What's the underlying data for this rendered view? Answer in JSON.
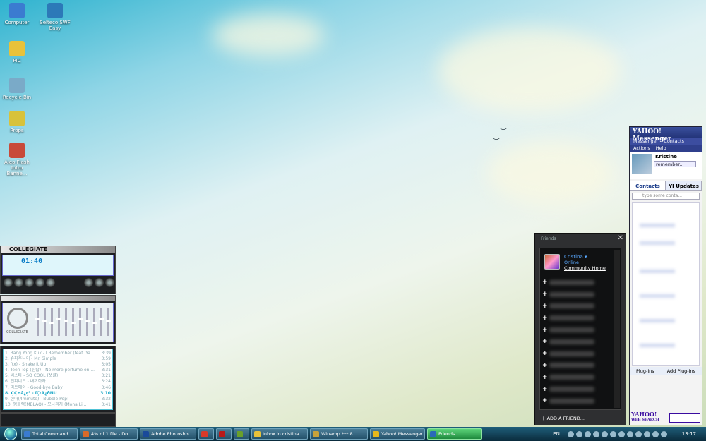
{
  "desktop": {
    "icons": [
      {
        "label": "Computer",
        "color": "#3b7bd0"
      },
      {
        "label": "Selteco SWF Easy",
        "color": "#2c79b8"
      },
      {
        "label": "PIC",
        "color": "#e8c23a"
      },
      {
        "label": "Recycle Bin",
        "color": "#7aaac8"
      },
      {
        "label": "Props",
        "color": "#d8c23a"
      },
      {
        "label": "Aleo Flash Intro Banne...",
        "color": "#c84a3a"
      }
    ]
  },
  "winamp": {
    "title": "COLLEGIATE",
    "time": "01:40",
    "eq_logo": "COLLEGIATE",
    "playlist": [
      {
        "title": "1. Bang Yong Kuk - I Remember (feat. Ya...",
        "time": "3:39"
      },
      {
        "title": "2. 슈퍼주니어 - Mr. Simple",
        "time": "3:59"
      },
      {
        "title": "3. f(x) - Shake It Up",
        "time": "3:05"
      },
      {
        "title": "4. Teen Top (틴탑) - No more perfume on ...",
        "time": "3:31"
      },
      {
        "title": "5. 씨스타 - SO COOL (쏘쿨)",
        "time": "3:21"
      },
      {
        "title": "6. 인피니트 - 내꺼하자",
        "time": "3:24"
      },
      {
        "title": "7. 미쓰에이 - Good-bye Baby",
        "time": "3:46"
      },
      {
        "title": "8. ÇÇ±â¿ç³ - ïÇ·À¿ðÑÛ",
        "time": "3:10"
      },
      {
        "title": "9. 현아(4minute) - Bubble Pop!",
        "time": "3:32"
      },
      {
        "title": "10. 엠블랙(MBLAQ) - 모나리자 (Mona Li...",
        "time": "3:41"
      }
    ],
    "current_index": 7
  },
  "friends": {
    "title": "Friends",
    "me": {
      "name": "Cristina",
      "status": "Online",
      "link": "Community Home"
    },
    "row_count": 11,
    "add_label": "ADD A FRIEND..."
  },
  "messenger": {
    "title": "YAHOO! Messenger",
    "menu1": [
      "Messenger",
      "Contacts"
    ],
    "menu2": [
      "Actions",
      "Help"
    ],
    "user_name": "Kristine",
    "status_text": "remember...",
    "tabs": [
      "Contacts",
      "YI Updates"
    ],
    "search_placeholder": "type some conta...",
    "bottom": [
      "Plug-ins",
      "Add Plug-ins"
    ],
    "logo": "YAHOO!",
    "logo_sub": "WEB SEARCH"
  },
  "taskbar": {
    "buttons": [
      {
        "label": "Total Command...",
        "color": "#3a7bd0",
        "active": false
      },
      {
        "label": "4% of 1 file - Do...",
        "color": "#d86a2a",
        "active": false
      },
      {
        "label": "Adobe Photosho...",
        "color": "#1a4a9a",
        "active": false
      },
      {
        "label": "",
        "color": "#d83a2a",
        "active": false
      },
      {
        "label": "",
        "color": "#b81a1a",
        "active": false
      },
      {
        "label": "",
        "color": "#6aa02a",
        "active": false
      },
      {
        "label": "Inbox in cristina...",
        "color": "#e8c23a",
        "active": false
      },
      {
        "label": "Winamp *** 8...",
        "color": "#c8a23a",
        "active": false
      },
      {
        "label": "Yahoo! Messenger",
        "color": "#e8b81a",
        "active": false
      },
      {
        "label": "Friends",
        "color": "#2a6ab8",
        "active": true
      }
    ],
    "language": "EN",
    "clock": "13:17"
  }
}
